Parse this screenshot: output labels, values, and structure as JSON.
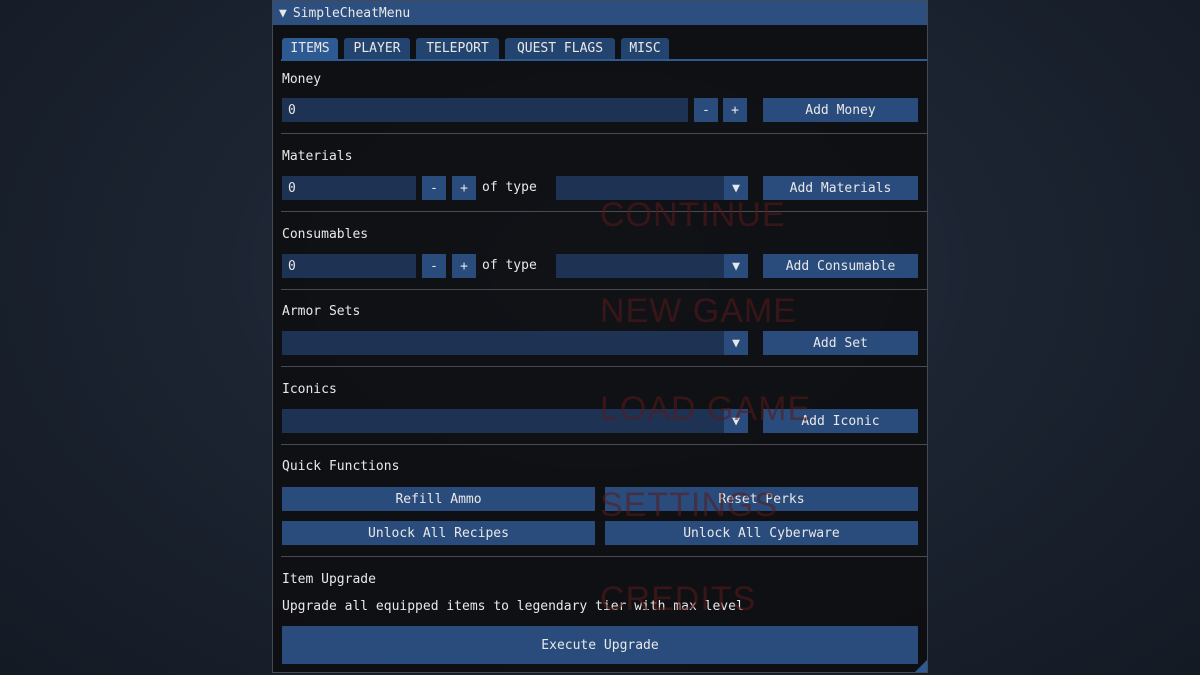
{
  "background_menu": [
    "CONTINUE",
    "NEW GAME",
    "LOAD GAME",
    "SETTINGS",
    "CREDITS"
  ],
  "window": {
    "title": "SimpleCheatMenu",
    "collapse_icon": "triangle-down"
  },
  "tabs": [
    {
      "label": "ITEMS",
      "active": true
    },
    {
      "label": "PLAYER"
    },
    {
      "label": "TELEPORT"
    },
    {
      "label": "QUEST FLAGS"
    },
    {
      "label": "MISC"
    }
  ],
  "money": {
    "label": "Money",
    "value": "0",
    "minus": "-",
    "plus": "+",
    "button": "Add Money"
  },
  "materials": {
    "label": "Materials",
    "value": "0",
    "minus": "-",
    "plus": "+",
    "of_type": "of type",
    "selected": "",
    "button": "Add Materials"
  },
  "consumables": {
    "label": "Consumables",
    "value": "0",
    "minus": "-",
    "plus": "+",
    "of_type": "of type",
    "selected": "",
    "button": "Add Consumable"
  },
  "armor": {
    "label": "Armor Sets",
    "selected": "",
    "button": "Add Set"
  },
  "iconics": {
    "label": "Iconics",
    "selected": "",
    "button": "Add Iconic"
  },
  "quick": {
    "label": "Quick Functions",
    "refill": "Refill Ammo",
    "reset": "Reset Perks",
    "recipes": "Unlock All Recipes",
    "cyberware": "Unlock All Cyberware"
  },
  "upgrade": {
    "label": "Item Upgrade",
    "description": "Upgrade all equipped items to legendary tier with max level",
    "button": "Execute Upgrade"
  },
  "colors": {
    "accent": "#2e5a94",
    "button": "#2a4c7c",
    "input": "#1e3254",
    "title_bar": "#2c4f7f"
  }
}
